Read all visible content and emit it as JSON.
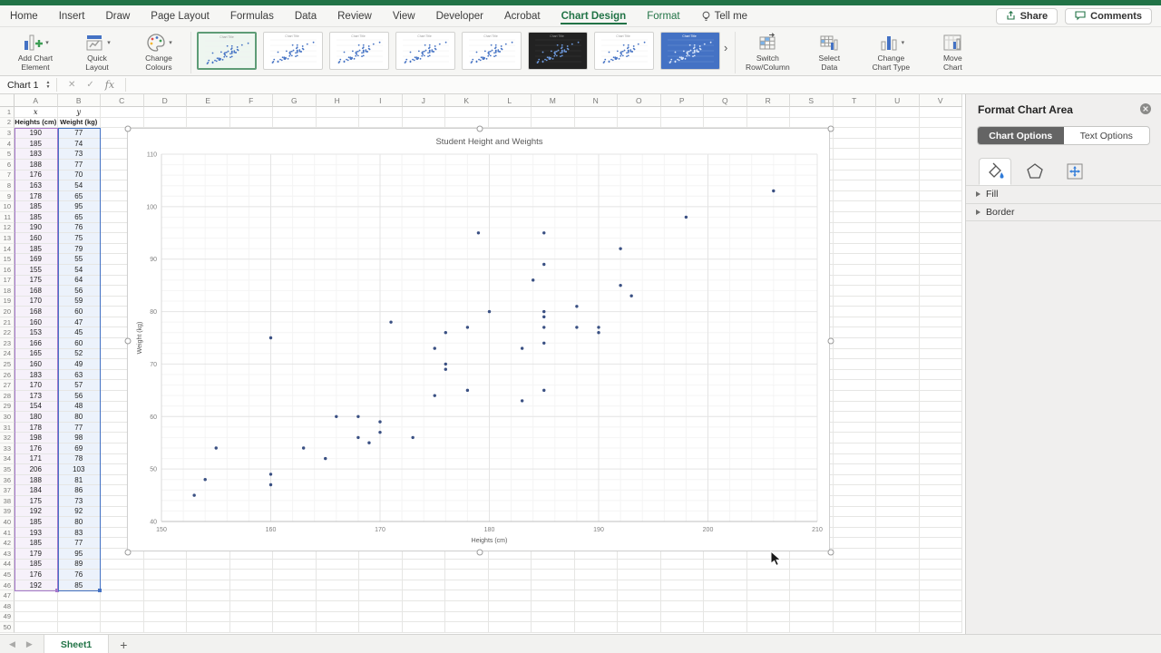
{
  "app": {
    "accent_green": "#217346",
    "point_color": "#3a5083"
  },
  "menu": {
    "tabs": [
      {
        "label": "Home"
      },
      {
        "label": "Insert"
      },
      {
        "label": "Draw"
      },
      {
        "label": "Page Layout"
      },
      {
        "label": "Formulas"
      },
      {
        "label": "Data"
      },
      {
        "label": "Review"
      },
      {
        "label": "View"
      },
      {
        "label": "Developer"
      },
      {
        "label": "Acrobat"
      },
      {
        "label": "Chart Design",
        "active": true
      },
      {
        "label": "Format",
        "green": true
      },
      {
        "label": "Tell me",
        "icon": "lightbulb-icon"
      }
    ],
    "share_label": "Share",
    "comments_label": "Comments"
  },
  "ribbon": {
    "left_buttons": [
      {
        "name": "add-chart-element",
        "line1": "Add Chart",
        "line2": "Element",
        "chevron": true,
        "icon": "chart-plus-icon"
      },
      {
        "name": "quick-layout",
        "line1": "Quick",
        "line2": "Layout",
        "chevron": true,
        "icon": "layout-icon"
      },
      {
        "name": "change-colours",
        "line1": "Change",
        "line2": "Colours",
        "chevron": true,
        "icon": "palette-icon"
      }
    ],
    "gallery_styles": [
      {
        "variant": "light",
        "selected": true
      },
      {
        "variant": "light"
      },
      {
        "variant": "light"
      },
      {
        "variant": "light"
      },
      {
        "variant": "light"
      },
      {
        "variant": "dark"
      },
      {
        "variant": "light"
      },
      {
        "variant": "blue"
      }
    ],
    "gallery_more": "›",
    "right_buttons": [
      {
        "name": "switch-row-column",
        "line1": "Switch",
        "line2": "Row/Column",
        "icon": "switch-icon"
      },
      {
        "name": "select-data",
        "line1": "Select",
        "line2": "Data",
        "icon": "select-data-icon"
      },
      {
        "name": "change-chart-type",
        "line1": "Change",
        "line2": "Chart Type",
        "chevron": true,
        "icon": "chart-type-icon"
      },
      {
        "name": "move-chart",
        "line1": "Move",
        "line2": "Chart",
        "icon": "move-chart-icon"
      }
    ]
  },
  "formula_bar": {
    "name_box": "Chart 1",
    "fx_label": "fx"
  },
  "sheet": {
    "columns": [
      "A",
      "B",
      "C",
      "D",
      "E",
      "F",
      "G",
      "H",
      "I",
      "J",
      "K",
      "L",
      "M",
      "N",
      "O",
      "P",
      "Q",
      "R",
      "S",
      "T",
      "U",
      "V"
    ],
    "row_count": 50,
    "header_row1": {
      "a": "x",
      "b": "y"
    },
    "header_row2": {
      "a": "Heights (cm)",
      "b": "Weight (kg)"
    },
    "tab_label": "Sheet1",
    "add_sheet_label": "+"
  },
  "chart_data": {
    "type": "scatter",
    "title": "Student Height and Weights",
    "xlabel": "Heights (cm)",
    "ylabel": "Weight (kg)",
    "xlim": [
      150,
      210
    ],
    "ylim": [
      40,
      110
    ],
    "x_ticks": [
      150,
      160,
      170,
      180,
      190,
      200,
      210
    ],
    "y_ticks": [
      40,
      50,
      60,
      70,
      80,
      90,
      100,
      110
    ],
    "minor_step_x": 2,
    "minor_step_y": 2,
    "grid": true,
    "legend": "none",
    "points": [
      [
        190,
        77
      ],
      [
        185,
        74
      ],
      [
        183,
        73
      ],
      [
        188,
        77
      ],
      [
        176,
        70
      ],
      [
        163,
        54
      ],
      [
        178,
        65
      ],
      [
        185,
        95
      ],
      [
        185,
        65
      ],
      [
        190,
        76
      ],
      [
        160,
        75
      ],
      [
        185,
        79
      ],
      [
        169,
        55
      ],
      [
        155,
        54
      ],
      [
        175,
        64
      ],
      [
        168,
        56
      ],
      [
        170,
        59
      ],
      [
        168,
        60
      ],
      [
        160,
        47
      ],
      [
        153,
        45
      ],
      [
        166,
        60
      ],
      [
        165,
        52
      ],
      [
        160,
        49
      ],
      [
        183,
        63
      ],
      [
        170,
        57
      ],
      [
        173,
        56
      ],
      [
        154,
        48
      ],
      [
        180,
        80
      ],
      [
        178,
        77
      ],
      [
        198,
        98
      ],
      [
        176,
        69
      ],
      [
        171,
        78
      ],
      [
        206,
        103
      ],
      [
        188,
        81
      ],
      [
        184,
        86
      ],
      [
        175,
        73
      ],
      [
        192,
        92
      ],
      [
        185,
        80
      ],
      [
        193,
        83
      ],
      [
        185,
        77
      ],
      [
        179,
        95
      ],
      [
        185,
        89
      ],
      [
        176,
        76
      ],
      [
        192,
        85
      ]
    ]
  },
  "format_panel": {
    "title": "Format Chart Area",
    "tabs": [
      {
        "label": "Chart Options",
        "selected": true
      },
      {
        "label": "Text Options"
      }
    ],
    "icon_tabs": [
      "fill-bucket-icon",
      "effects-pentagon-icon",
      "size-properties-icon"
    ],
    "sections": [
      {
        "label": "Fill"
      },
      {
        "label": "Border"
      }
    ]
  }
}
